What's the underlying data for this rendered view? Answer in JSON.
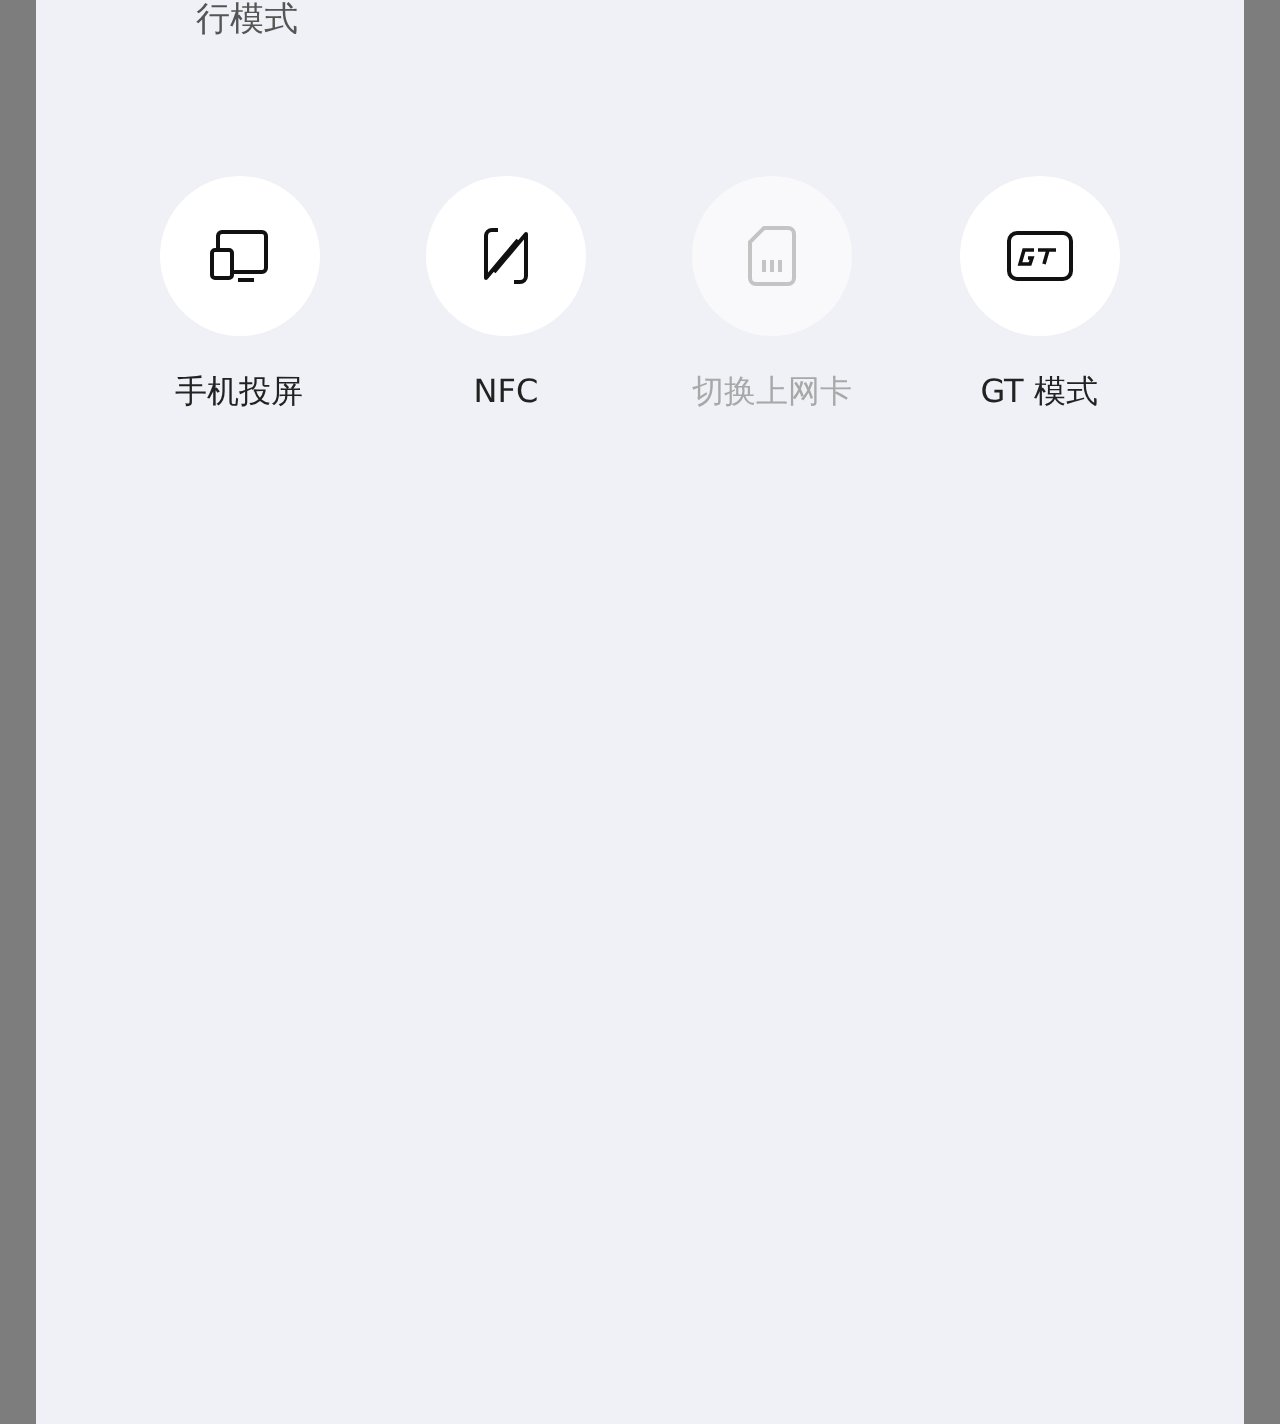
{
  "header": {
    "title": "行模式"
  },
  "tiles": [
    {
      "label": "手机投屏",
      "kind": "cast",
      "disabled": false
    },
    {
      "label": "NFC",
      "kind": "nfc",
      "disabled": false
    },
    {
      "label": "切换上网卡",
      "kind": "sim",
      "disabled": true
    },
    {
      "label": "GT 模式",
      "kind": "gt",
      "disabled": false
    }
  ]
}
